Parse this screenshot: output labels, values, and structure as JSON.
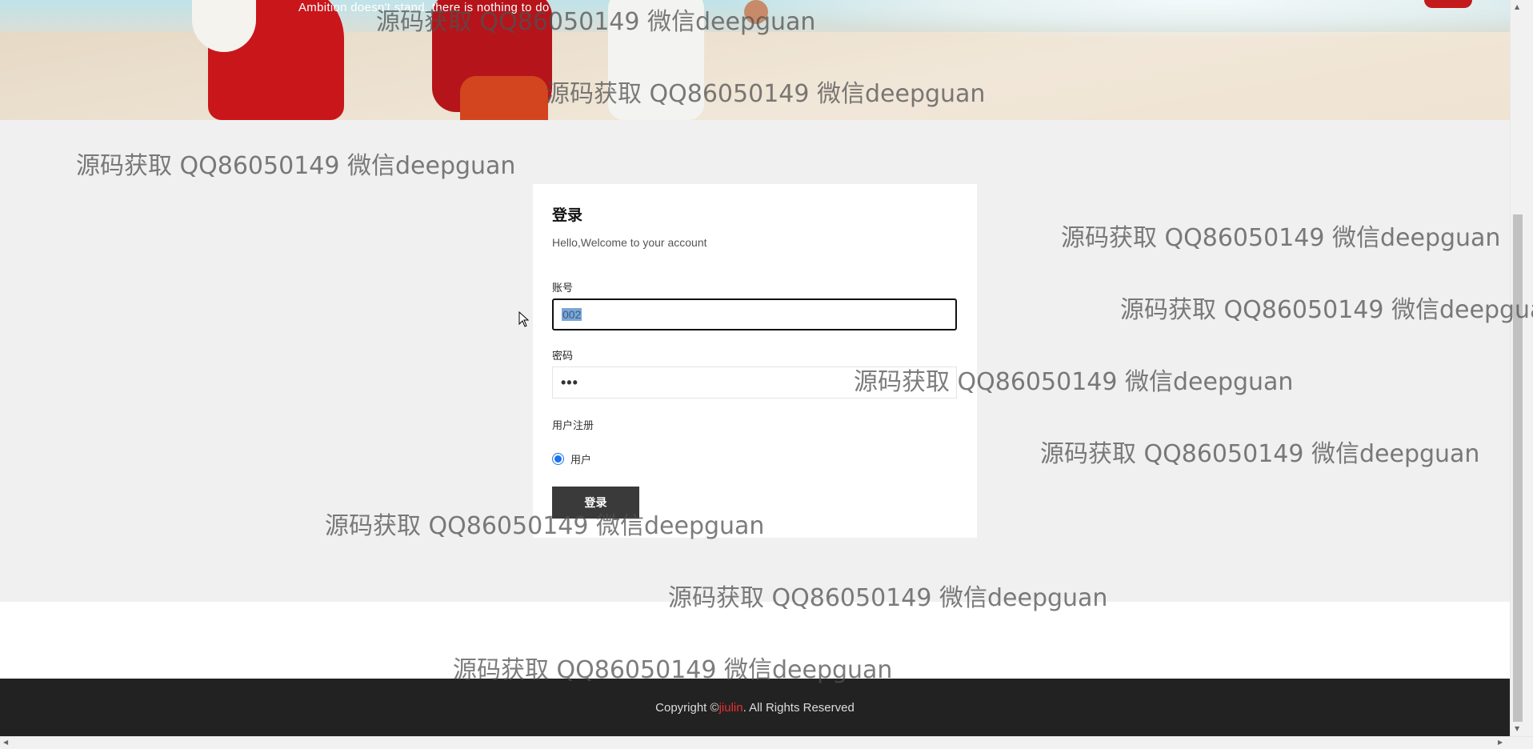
{
  "hero": {
    "tagline": "Ambition doesn't stand, there is nothing to do"
  },
  "login": {
    "title": "登录",
    "subtitle": "Hello,Welcome to your account",
    "account_label": "账号",
    "account_value": "002",
    "password_label": "密码",
    "password_value": "•••",
    "register_link": "用户注册",
    "role_option": "用户",
    "submit_label": "登录"
  },
  "footer": {
    "prefix": "Copyright © ",
    "brand": "jiulin",
    "suffix": ". All Rights Reserved"
  },
  "watermark": "源码获取 QQ86050149 微信deepguan",
  "colors": {
    "footer_bg": "#222222",
    "brand_red": "#e8302e",
    "button_bg": "#3a3a3a",
    "radio_blue": "#1a73e8"
  }
}
